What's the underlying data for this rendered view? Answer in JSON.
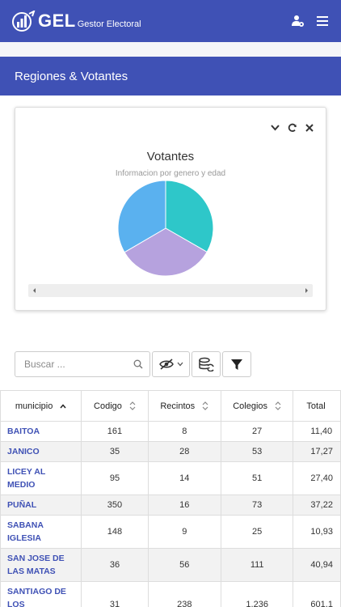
{
  "app": {
    "logo_text": "GEL",
    "logo_sub": "Gestor Electoral"
  },
  "panel": {
    "title": "Regiones & Votantes"
  },
  "chart_data": {
    "type": "pie",
    "title": "Votantes",
    "subtitle": "Informacion por genero y edad",
    "slices": [
      {
        "value": 33.3,
        "color": "#2ec7c9"
      },
      {
        "value": 33.3,
        "color": "#b6a2de"
      },
      {
        "value": 33.4,
        "color": "#5ab1ef"
      }
    ]
  },
  "toolbar": {
    "search_placeholder": "Buscar ..."
  },
  "table": {
    "headers": [
      "municipio",
      "Codigo",
      "Recintos",
      "Colegios",
      "Total"
    ],
    "rows": [
      {
        "municipio": "BAITOA",
        "codigo": "161",
        "recintos": "8",
        "colegios": "27",
        "total": "11,40"
      },
      {
        "municipio": "JANICO",
        "codigo": "35",
        "recintos": "28",
        "colegios": "53",
        "total": "17,27"
      },
      {
        "municipio": "LICEY AL MEDIO",
        "codigo": "95",
        "recintos": "14",
        "colegios": "51",
        "total": "27,40"
      },
      {
        "municipio": "PUÑAL",
        "codigo": "350",
        "recintos": "16",
        "colegios": "73",
        "total": "37,22"
      },
      {
        "municipio": "SABANA IGLESIA",
        "codigo": "148",
        "recintos": "9",
        "colegios": "25",
        "total": "10,93"
      },
      {
        "municipio": "SAN JOSE DE LAS MATAS",
        "codigo": "36",
        "recintos": "56",
        "colegios": "111",
        "total": "40,94"
      },
      {
        "municipio": "SANTIAGO DE LOS CABALLEROS",
        "codigo": "31",
        "recintos": "238",
        "colegios": "1,236",
        "total": "601,1"
      }
    ]
  }
}
